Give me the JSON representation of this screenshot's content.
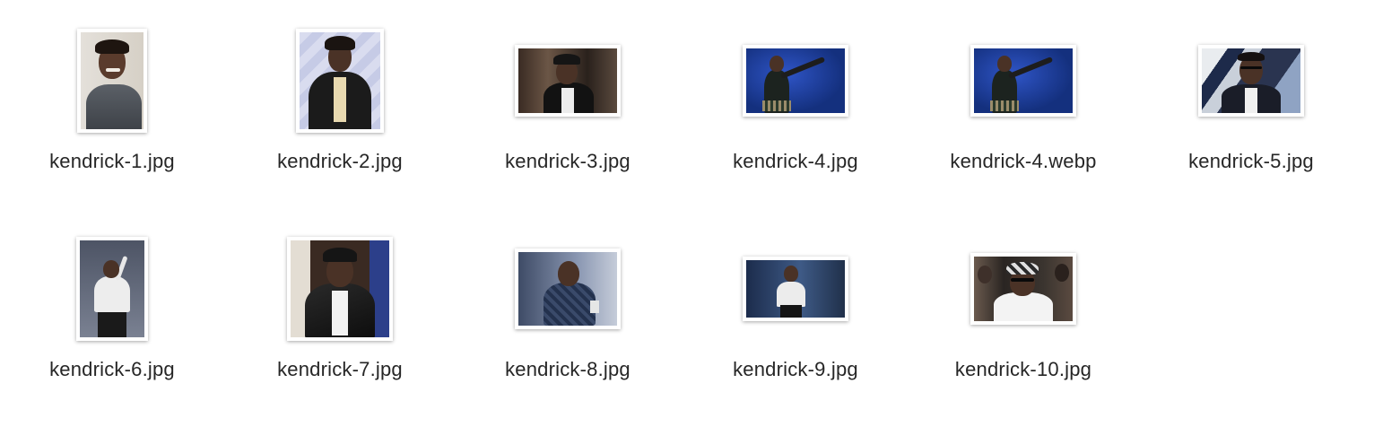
{
  "files": [
    {
      "name": "kendrick-1.jpg"
    },
    {
      "name": "kendrick-2.jpg"
    },
    {
      "name": "kendrick-3.jpg"
    },
    {
      "name": "kendrick-4.jpg"
    },
    {
      "name": "kendrick-4.webp"
    },
    {
      "name": "kendrick-5.jpg"
    },
    {
      "name": "kendrick-6.jpg"
    },
    {
      "name": "kendrick-7.jpg"
    },
    {
      "name": "kendrick-8.jpg"
    },
    {
      "name": "kendrick-9.jpg"
    },
    {
      "name": "kendrick-10.jpg"
    }
  ]
}
